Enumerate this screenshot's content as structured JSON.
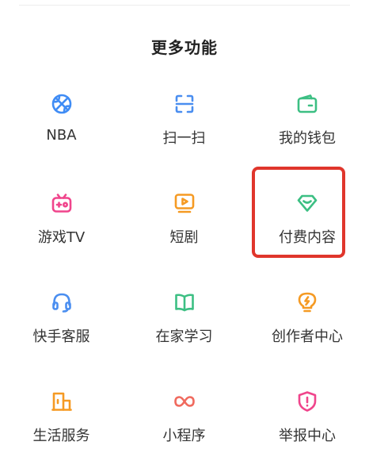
{
  "section": {
    "title": "更多功能"
  },
  "items": [
    {
      "label": "NBA",
      "icon": "basketball-icon",
      "color": "#3f8cf5"
    },
    {
      "label": "扫一扫",
      "icon": "scan-icon",
      "color": "#4a8ef0"
    },
    {
      "label": "我的钱包",
      "icon": "wallet-icon",
      "color": "#3cbf83"
    },
    {
      "label": "游戏TV",
      "icon": "tv-icon",
      "color": "#f0458c"
    },
    {
      "label": "短剧",
      "icon": "video-play-icon",
      "color": "#f59a23"
    },
    {
      "label": "付费内容",
      "icon": "diamond-icon",
      "color": "#3cbf83"
    },
    {
      "label": "快手客服",
      "icon": "headset-icon",
      "color": "#4a8ef0"
    },
    {
      "label": "在家学习",
      "icon": "book-icon",
      "color": "#3cbf83"
    },
    {
      "label": "创作者中心",
      "icon": "lightbulb-icon",
      "color": "#f59a23"
    },
    {
      "label": "生活服务",
      "icon": "shop-icon",
      "color": "#f59a23"
    },
    {
      "label": "小程序",
      "icon": "infinity-icon",
      "color": "#f06a5e"
    },
    {
      "label": "举报中心",
      "icon": "shield-alert-icon",
      "color": "#f0458c"
    }
  ],
  "highlight": {
    "target": "付费内容",
    "color": "#e0362c"
  }
}
